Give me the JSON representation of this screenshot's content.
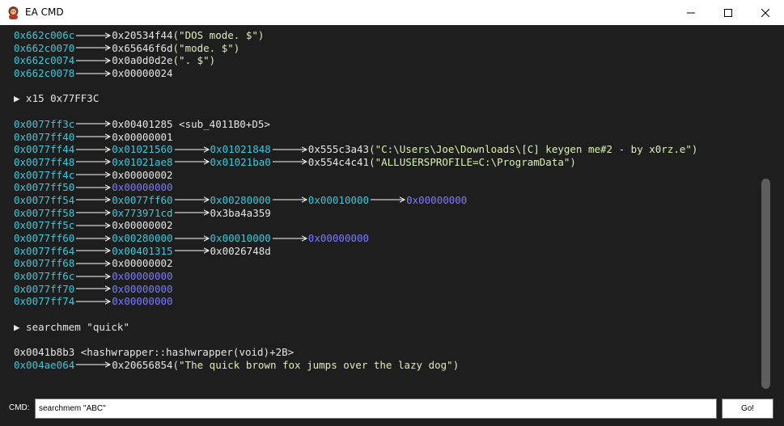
{
  "window": {
    "title": "EA CMD"
  },
  "console": {
    "lines": [
      {
        "segs": [
          {
            "t": "addr",
            "v": "0x662c006c"
          },
          {
            "t": "arrow"
          },
          {
            "t": "val",
            "v": "0x20534f44"
          },
          {
            "t": "str",
            "v": "(\"DOS mode. $\")"
          }
        ]
      },
      {
        "segs": [
          {
            "t": "addr",
            "v": "0x662c0070"
          },
          {
            "t": "arrow"
          },
          {
            "t": "val",
            "v": "0x65646f6d"
          },
          {
            "t": "str",
            "v": "(\"mode. $\")"
          }
        ]
      },
      {
        "segs": [
          {
            "t": "addr",
            "v": "0x662c0074"
          },
          {
            "t": "arrow"
          },
          {
            "t": "val",
            "v": "0x0a0d0d2e"
          },
          {
            "t": "str",
            "v": "(\". $\")"
          }
        ]
      },
      {
        "segs": [
          {
            "t": "addr",
            "v": "0x662c0078"
          },
          {
            "t": "arrow"
          },
          {
            "t": "val",
            "v": "0x00000024"
          }
        ]
      },
      {
        "gap": true
      },
      {
        "segs": [
          {
            "t": "val",
            "v": "▶ x15 0x77FF3C"
          }
        ]
      },
      {
        "gap": true
      },
      {
        "segs": [
          {
            "t": "addr",
            "v": "0x0077ff3c"
          },
          {
            "t": "arrow"
          },
          {
            "t": "val",
            "v": "0x00401285 <sub_4011B0+D5>"
          }
        ]
      },
      {
        "segs": [
          {
            "t": "addr",
            "v": "0x0077ff40"
          },
          {
            "t": "arrow"
          },
          {
            "t": "val",
            "v": "0x00000001"
          }
        ]
      },
      {
        "segs": [
          {
            "t": "addr",
            "v": "0x0077ff44"
          },
          {
            "t": "arrow"
          },
          {
            "t": "addr",
            "v": "0x01021560"
          },
          {
            "t": "arrow"
          },
          {
            "t": "addr",
            "v": "0x01021848"
          },
          {
            "t": "arrow"
          },
          {
            "t": "val",
            "v": "0x555c3a43"
          },
          {
            "t": "str",
            "v": "(\"C:\\Users\\Joe\\Downloads\\[C] keygen me#2 - by x0rz.e\")"
          }
        ]
      },
      {
        "segs": [
          {
            "t": "addr",
            "v": "0x0077ff48"
          },
          {
            "t": "arrow"
          },
          {
            "t": "addr",
            "v": "0x01021ae8"
          },
          {
            "t": "arrow"
          },
          {
            "t": "addr",
            "v": "0x01021ba0"
          },
          {
            "t": "arrow"
          },
          {
            "t": "val",
            "v": "0x554c4c41"
          },
          {
            "t": "str",
            "v": "(\"ALLUSERSPROFILE=C:\\ProgramData\")"
          }
        ]
      },
      {
        "segs": [
          {
            "t": "addr",
            "v": "0x0077ff4c"
          },
          {
            "t": "arrow"
          },
          {
            "t": "val",
            "v": "0x00000002"
          }
        ]
      },
      {
        "segs": [
          {
            "t": "addr",
            "v": "0x0077ff50"
          },
          {
            "t": "arrow"
          },
          {
            "t": "zero",
            "v": "0x00000000"
          }
        ]
      },
      {
        "segs": [
          {
            "t": "addr",
            "v": "0x0077ff54"
          },
          {
            "t": "arrow"
          },
          {
            "t": "addr",
            "v": "0x0077ff60"
          },
          {
            "t": "arrow"
          },
          {
            "t": "addr",
            "v": "0x00280000"
          },
          {
            "t": "arrow"
          },
          {
            "t": "addr",
            "v": "0x00010000"
          },
          {
            "t": "arrow"
          },
          {
            "t": "zero",
            "v": "0x00000000"
          }
        ]
      },
      {
        "segs": [
          {
            "t": "addr",
            "v": "0x0077ff58"
          },
          {
            "t": "arrow"
          },
          {
            "t": "addr",
            "v": "0x773971cd"
          },
          {
            "t": "arrow"
          },
          {
            "t": "val",
            "v": "0x3ba4a359"
          }
        ]
      },
      {
        "segs": [
          {
            "t": "addr",
            "v": "0x0077ff5c"
          },
          {
            "t": "arrow"
          },
          {
            "t": "val",
            "v": "0x00000002"
          }
        ]
      },
      {
        "segs": [
          {
            "t": "addr",
            "v": "0x0077ff60"
          },
          {
            "t": "arrow"
          },
          {
            "t": "addr",
            "v": "0x00280000"
          },
          {
            "t": "arrow"
          },
          {
            "t": "addr",
            "v": "0x00010000"
          },
          {
            "t": "arrow"
          },
          {
            "t": "zero",
            "v": "0x00000000"
          }
        ]
      },
      {
        "segs": [
          {
            "t": "addr",
            "v": "0x0077ff64"
          },
          {
            "t": "arrow"
          },
          {
            "t": "addr",
            "v": "0x00401315"
          },
          {
            "t": "arrow"
          },
          {
            "t": "val",
            "v": "0x0026748d"
          }
        ]
      },
      {
        "segs": [
          {
            "t": "addr",
            "v": "0x0077ff68"
          },
          {
            "t": "arrow"
          },
          {
            "t": "val",
            "v": "0x00000002"
          }
        ]
      },
      {
        "segs": [
          {
            "t": "addr",
            "v": "0x0077ff6c"
          },
          {
            "t": "arrow"
          },
          {
            "t": "zero",
            "v": "0x00000000"
          }
        ]
      },
      {
        "segs": [
          {
            "t": "addr",
            "v": "0x0077ff70"
          },
          {
            "t": "arrow"
          },
          {
            "t": "zero",
            "v": "0x00000000"
          }
        ]
      },
      {
        "segs": [
          {
            "t": "addr",
            "v": "0x0077ff74"
          },
          {
            "t": "arrow"
          },
          {
            "t": "zero",
            "v": "0x00000000"
          }
        ]
      },
      {
        "gap": true
      },
      {
        "segs": [
          {
            "t": "val",
            "v": "▶ searchmem \"quick\""
          }
        ]
      },
      {
        "gap": true
      },
      {
        "segs": [
          {
            "t": "val",
            "v": "0x0041b8b3 <hashwrapper::hashwrapper(void)+2B>"
          }
        ]
      },
      {
        "segs": [
          {
            "t": "addr",
            "v": "0x004ae064"
          },
          {
            "t": "arrow"
          },
          {
            "t": "val",
            "v": "0x20656854"
          },
          {
            "t": "str",
            "v": "(\"The quick brown fox jumps over the lazy dog\")"
          }
        ]
      }
    ]
  },
  "cmd": {
    "label": "CMD:",
    "value": "searchmem \"ABC\"",
    "go_label": "Go!"
  },
  "colors": {
    "background": "#1e1e1e",
    "address": "#3ec8d8",
    "value": "#e6e6e6",
    "zero": "#7b7bff",
    "string": "#d9f0b8"
  },
  "icons": {
    "app": "portrait-icon",
    "minimize": "minimize-icon",
    "maximize": "maximize-icon",
    "close": "close-icon"
  }
}
